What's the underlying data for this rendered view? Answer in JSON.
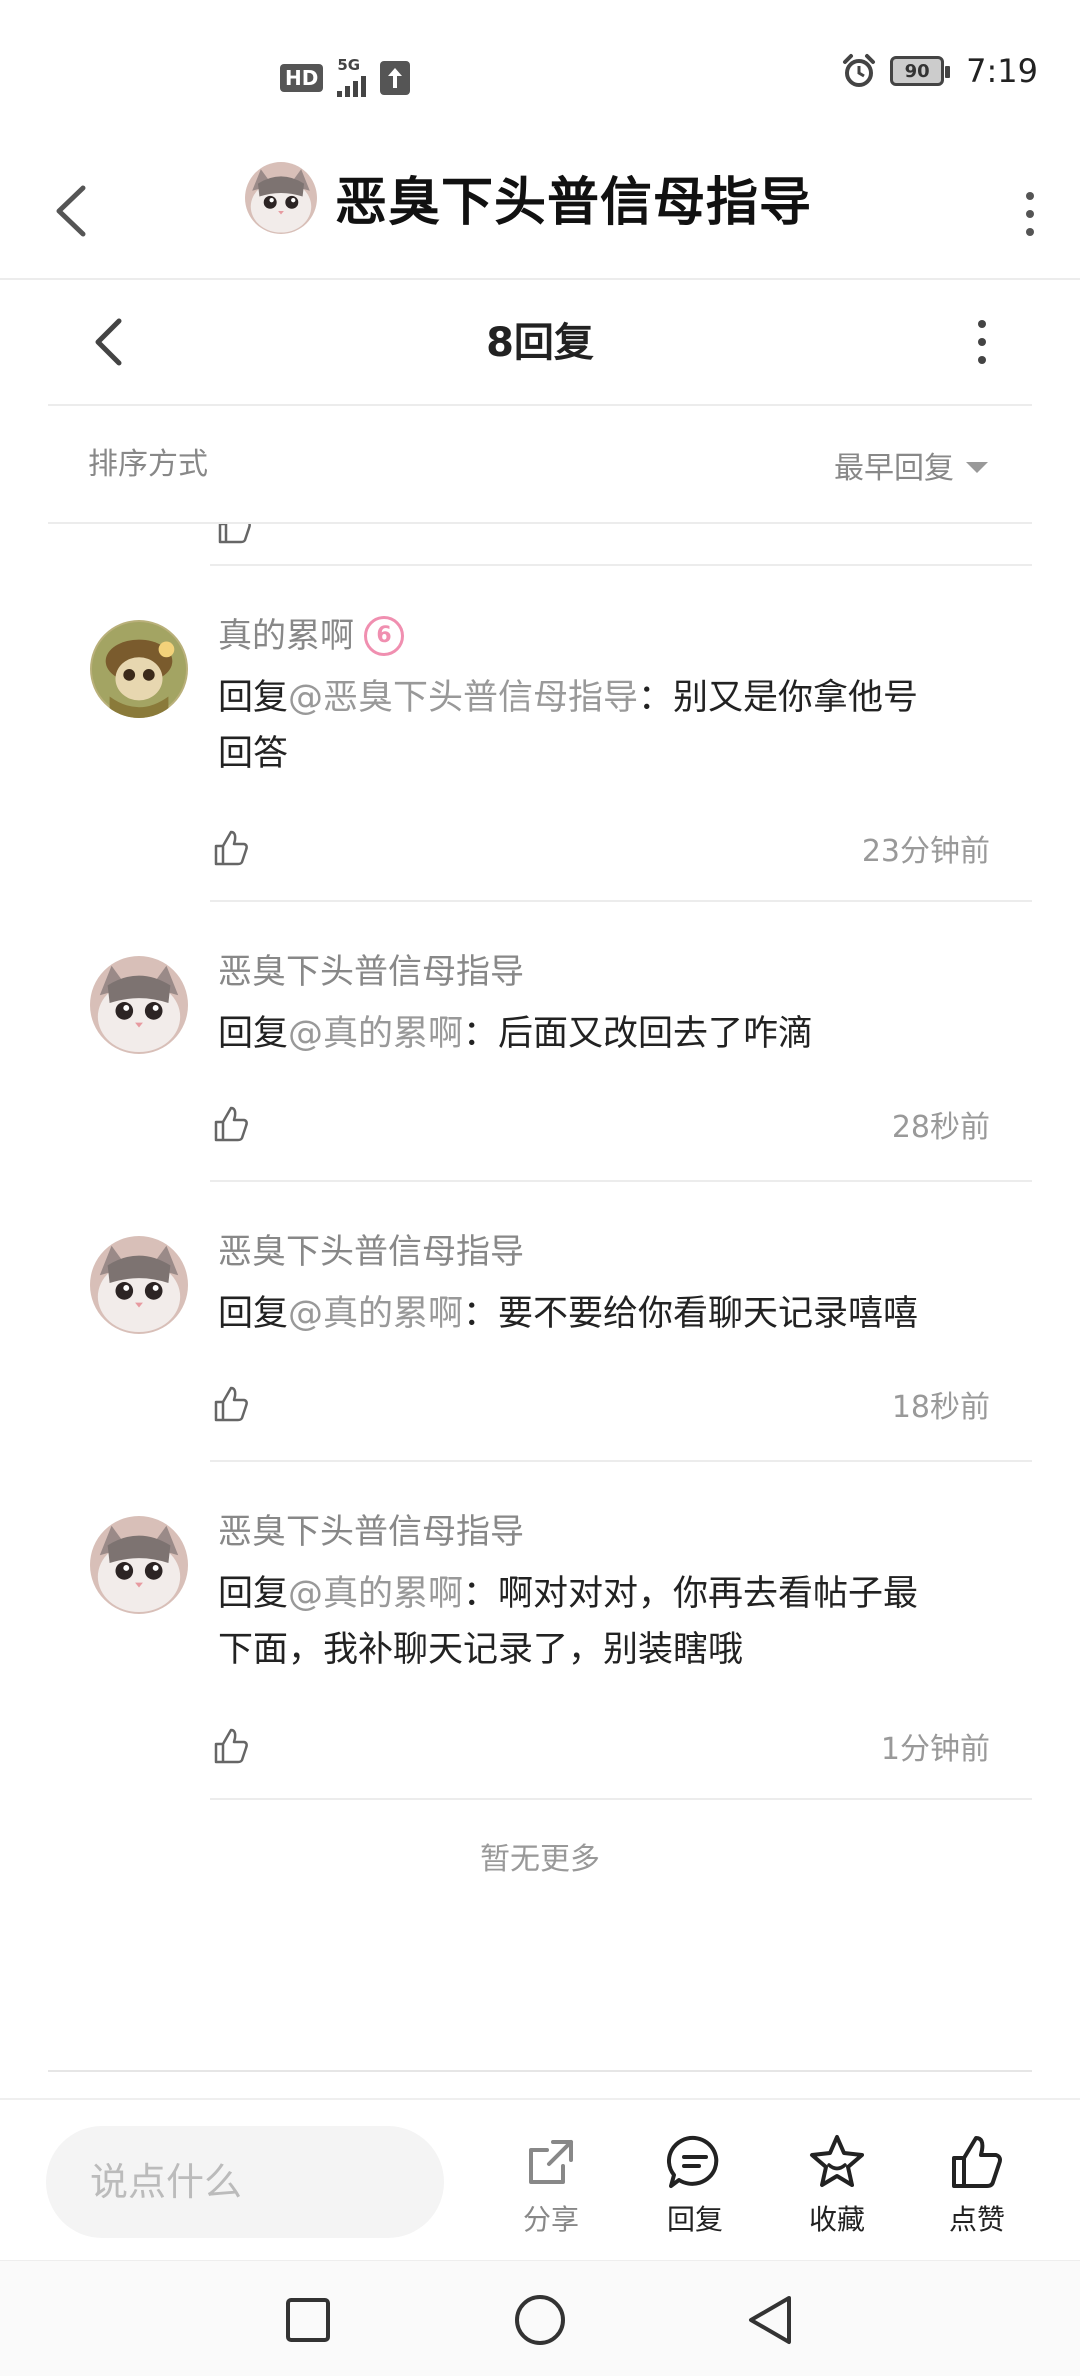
{
  "status_bar": {
    "hd": "HD",
    "network": "5G",
    "battery": "90",
    "time": "7:19"
  },
  "header": {
    "title": "恶臭下头普信母指导"
  },
  "sub_header": {
    "title": "8回复"
  },
  "sort": {
    "label": "排序方式",
    "selected": "最早回复"
  },
  "comments": [
    {
      "name": "真的累啊",
      "level": "6",
      "reply_prefix": "回复",
      "mention": "@恶臭下头普信母指导",
      "text_line1": "：别又是你拿他号",
      "text_line2": "回答",
      "time": "23分钟前"
    },
    {
      "name": "恶臭下头普信母指导",
      "reply_prefix": "回复",
      "mention": "@真的累啊",
      "text_line1": "：后面又改回去了咋滴",
      "time": "28秒前"
    },
    {
      "name": "恶臭下头普信母指导",
      "reply_prefix": "回复",
      "mention": "@真的累啊",
      "text_line1": "：要不要给你看聊天记录嘻嘻",
      "time": "18秒前"
    },
    {
      "name": "恶臭下头普信母指导",
      "reply_prefix": "回复",
      "mention": "@真的累啊",
      "text_line1": "：啊对对对，你再去看帖子最",
      "text_line2": "下面，我补聊天记录了，别装瞎哦",
      "time": "1分钟前"
    }
  ],
  "no_more": "暂无更多",
  "action_bar": {
    "input_placeholder": "说点什么",
    "share": "分享",
    "reply": "回复",
    "favorite": "收藏",
    "like": "点赞"
  },
  "colors": {
    "muted": "#888888",
    "badge_pink": "#f08fb0"
  }
}
